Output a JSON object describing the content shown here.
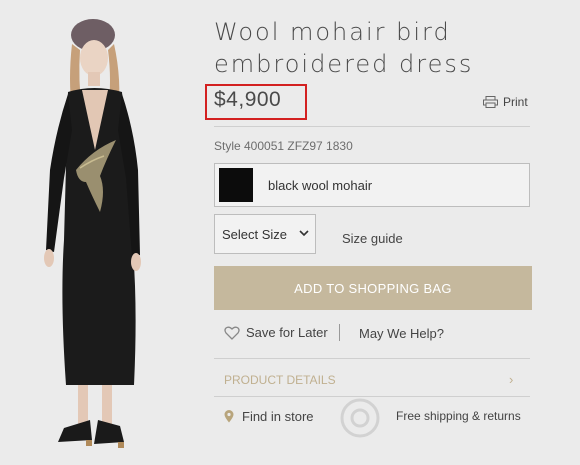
{
  "product": {
    "title": "Wool mohair bird embroidered dress",
    "price": "$4,900",
    "print_label": "Print",
    "style_number": "Style 400051 ZFZ97 1830",
    "color_name": "black wool mohair",
    "size_select_label": "Select Size",
    "size_guide_label": "Size guide",
    "add_to_bag_label": "ADD TO SHOPPING BAG",
    "save_for_later_label": "Save for Later",
    "help_label": "May We Help?",
    "product_details_label": "PRODUCT DETAILS",
    "find_in_store_label": "Find in store",
    "free_shipping_label": "Free shipping & returns"
  },
  "colors": {
    "accent": "#c5b89d",
    "highlight_border": "#d32020",
    "swatch": "#0c0c0c"
  },
  "icons": {
    "print": "printer-icon",
    "save": "heart-icon",
    "store": "location-pin-icon",
    "select": "chevron-down-icon",
    "details": "chevron-right-icon"
  }
}
